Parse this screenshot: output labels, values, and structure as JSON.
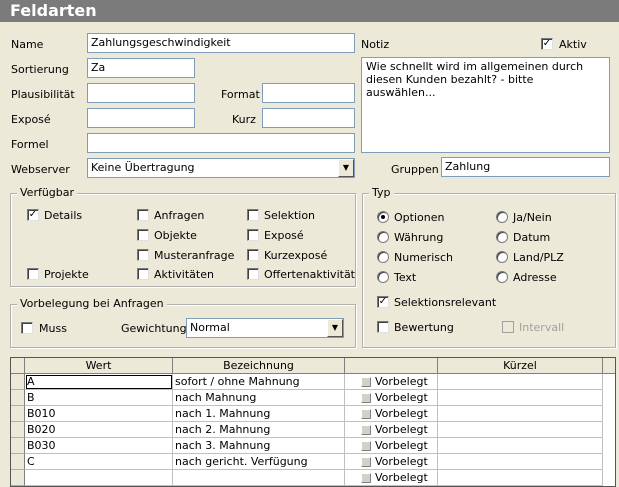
{
  "window": {
    "title": "Feldarten"
  },
  "form": {
    "name_label": "Name",
    "name_value": "Zahlungsgeschwindigkeit",
    "notiz_label": "Notiz",
    "aktiv_label": "Aktiv",
    "aktiv_checked": true,
    "sortierung_label": "Sortierung",
    "sortierung_value": "Za",
    "notiz_value": "Wie schnellt wird im allgemeinen durch diesen Kunden bezahlt?  - bitte auswählen...",
    "plausibilitaet_label": "Plausibilität",
    "plausibilitaet_value": "",
    "format_label": "Format",
    "format_value": "",
    "expose_label": "Exposé",
    "expose_value": "",
    "kurz_label": "Kurz",
    "kurz_value": "",
    "formel_label": "Formel",
    "formel_value": "",
    "webserver_label": "Webserver",
    "webserver_value": "Keine Übertragung",
    "gruppen_label": "Gruppen",
    "gruppen_value": "Zahlung"
  },
  "verfuegbar": {
    "title": "Verfügbar",
    "details": {
      "label": "Details",
      "checked": true
    },
    "projekte": {
      "label": "Projekte",
      "checked": false
    },
    "anfragen": {
      "label": "Anfragen",
      "checked": false
    },
    "objekte": {
      "label": "Objekte",
      "checked": false
    },
    "musteranfrage": {
      "label": "Musteranfrage",
      "checked": false
    },
    "aktivitaeten": {
      "label": "Aktivitäten",
      "checked": false
    },
    "selektion": {
      "label": "Selektion",
      "checked": false
    },
    "expose": {
      "label": "Exposé",
      "checked": false
    },
    "kurzexpose": {
      "label": "Kurzexposé",
      "checked": false
    },
    "offertenaktivitaet": {
      "label": "Offertenaktivität",
      "checked": false
    }
  },
  "vorbelegung": {
    "title": "Vorbelegung bei Anfragen",
    "muss_label": "Muss",
    "gewichtung_label": "Gewichtung",
    "gewichtung_value": "Normal"
  },
  "typ": {
    "title": "Typ",
    "optionen": "Optionen",
    "waehrung": "Währung",
    "numerisch": "Numerisch",
    "text": "Text",
    "janein": "Ja/Nein",
    "datum": "Datum",
    "landplz": "Land/PLZ",
    "adresse": "Adresse",
    "selected": "Optionen",
    "selektionsrelevant_label": "Selektionsrelevant",
    "selektionsrelevant_checked": true,
    "bewertung_label": "Bewertung",
    "intervall_label": "Intervall"
  },
  "table": {
    "headers": [
      "Wert",
      "Bezeichnung",
      "",
      "Kürzel"
    ],
    "vorbelegt_label": "Vorbelegt",
    "rows": [
      {
        "wert": "A",
        "bezeichnung": "sofort / ohne Mahnung",
        "kuerzel": ""
      },
      {
        "wert": "B",
        "bezeichnung": "nach Mahnung",
        "kuerzel": ""
      },
      {
        "wert": "B010",
        "bezeichnung": "nach 1. Mahnung",
        "kuerzel": ""
      },
      {
        "wert": "B020",
        "bezeichnung": "nach 2. Mahnung",
        "kuerzel": ""
      },
      {
        "wert": "B030",
        "bezeichnung": "nach 3. Mahnung",
        "kuerzel": ""
      },
      {
        "wert": "C",
        "bezeichnung": "nach gericht. Verfügung",
        "kuerzel": ""
      },
      {
        "wert": "",
        "bezeichnung": "",
        "kuerzel": ""
      }
    ]
  }
}
